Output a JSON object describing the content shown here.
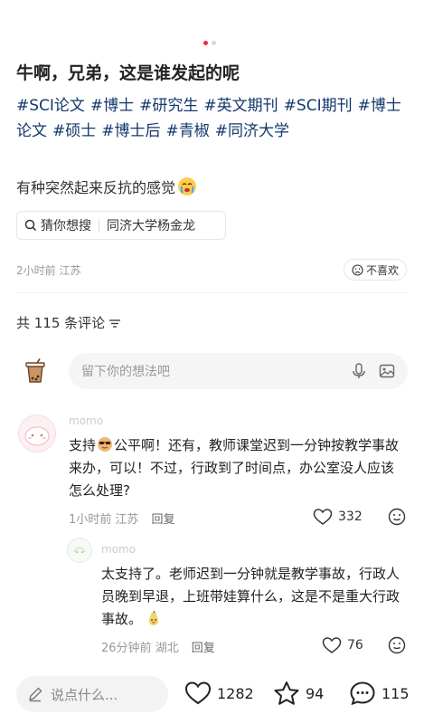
{
  "post": {
    "title": "牛啊，兄弟，这是谁发起的呢",
    "tags": [
      "#SCI论文",
      "#博士",
      "#研究生",
      "#英文期刊",
      "#SCI期刊",
      "#博士论文",
      "#硕士",
      "#博士后",
      "#青椒",
      "#同济大学"
    ],
    "body": "有种突然起来反抗的感觉",
    "search_chip": {
      "label": "猜你想搜",
      "query": "同济大学杨金龙"
    },
    "time": "2小时前",
    "location": "江苏",
    "dislike_label": "不喜欢",
    "comment_count_label": "共 115 条评论"
  },
  "comment_input": {
    "placeholder": "留下你的想法吧"
  },
  "comments": [
    {
      "name": "momo",
      "text_before": "支持",
      "text_after": "公平啊！还有，教师课堂迟到一分钟按教学事故来办，可以！不过，行政到了时间点，办公室没人应该怎么处理?",
      "time": "1小时前",
      "location": "江苏",
      "reply_label": "回复",
      "likes": "332"
    },
    {
      "name": "momo",
      "text": "太支持了。老师迟到一分钟就是教学事故，行政人员晚到早退，上班带娃算什么，这是不是重大行政事故。",
      "time": "26分钟前",
      "location": "湖北",
      "reply_label": "回复",
      "likes": "76"
    }
  ],
  "bottom_bar": {
    "say_placeholder": "说点什么...",
    "likes": "1282",
    "stars": "94",
    "comments": "115"
  },
  "colors": {
    "accent": "#ff2442",
    "tag": "#13386c"
  }
}
